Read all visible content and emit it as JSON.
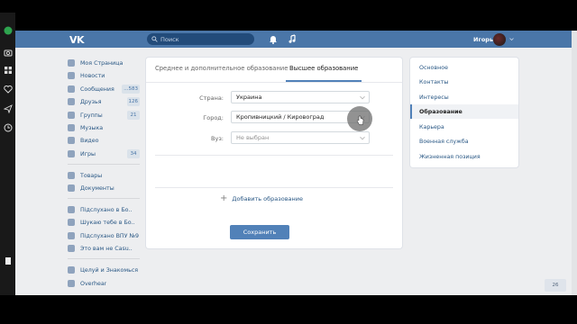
{
  "header": {
    "logo": "VK",
    "search_placeholder": "Поиск",
    "user_name": "Игорь"
  },
  "sidebar": {
    "items": [
      {
        "label": "Моя Страница",
        "badge": ""
      },
      {
        "label": "Новости",
        "badge": ""
      },
      {
        "label": "Сообщения",
        "badge": "...583"
      },
      {
        "label": "Друзья",
        "badge": "126"
      },
      {
        "label": "Группы",
        "badge": "21"
      },
      {
        "label": "Музыка",
        "badge": ""
      },
      {
        "label": "Видео",
        "badge": ""
      },
      {
        "label": "Игры",
        "badge": "34"
      },
      {
        "label": "Товары",
        "badge": ""
      },
      {
        "label": "Документы",
        "badge": ""
      },
      {
        "label": "Підслухано в Бо..",
        "badge": ""
      },
      {
        "label": "Шукаю тебе в Бо..",
        "badge": ""
      },
      {
        "label": "Підслухано ВПУ №9",
        "badge": ""
      },
      {
        "label": "Это вам не Casu..",
        "badge": ""
      },
      {
        "label": "Целуй и Знакомься",
        "badge": ""
      },
      {
        "label": "Overhear",
        "badge": ""
      }
    ]
  },
  "education": {
    "tabs": [
      {
        "label": "Среднее и дополнительное образование"
      },
      {
        "label": "Высшее образование"
      }
    ],
    "country_label": "Страна:",
    "country_value": "Украина",
    "city_label": "Город:",
    "city_value": "Кропивницкий / Кировоград",
    "university_label": "Вуз:",
    "university_value": "Не выбран",
    "add_label": "Добавить образование",
    "save_label": "Сохранить"
  },
  "settings_nav": {
    "items": [
      {
        "label": "Основное"
      },
      {
        "label": "Контакты"
      },
      {
        "label": "Интересы"
      },
      {
        "label": "Образование"
      },
      {
        "label": "Карьера"
      },
      {
        "label": "Военная служба"
      },
      {
        "label": "Жизненная позиция"
      }
    ]
  },
  "chat": {
    "count": "26"
  },
  "colors": {
    "accent": "#4a76a8",
    "button": "#5181b8",
    "link": "#2a5885"
  }
}
